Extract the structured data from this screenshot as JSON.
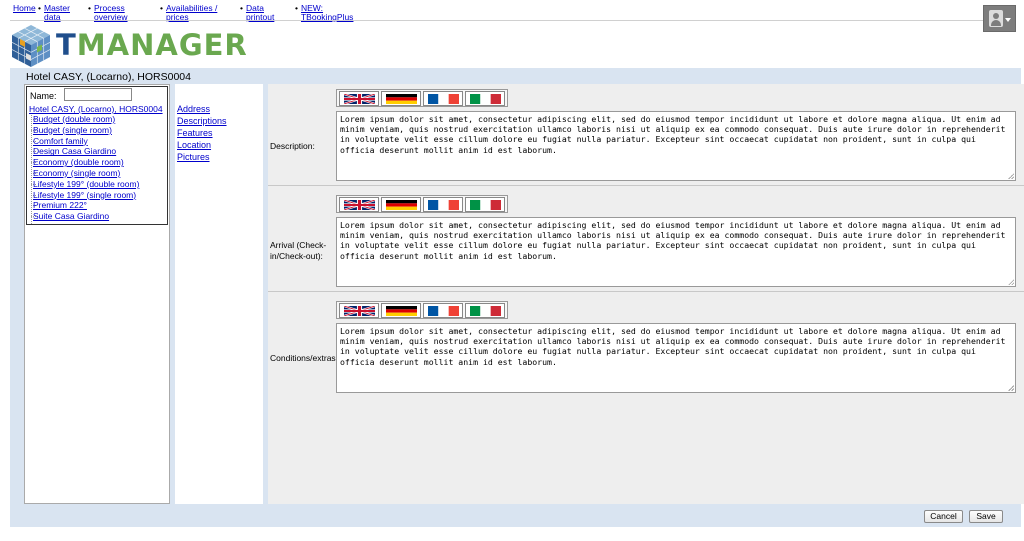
{
  "nav": {
    "items": [
      {
        "label": "Home"
      },
      {
        "label": "Master data"
      },
      {
        "label": "Process overview"
      },
      {
        "label": "Availabilities / prices"
      },
      {
        "label": "Data printout"
      },
      {
        "label": "NEW: TBookingPlus"
      }
    ]
  },
  "logo": {
    "text_t": "T",
    "text_rest": "MANAGER"
  },
  "hotel": {
    "title": "Hotel CASY, (Locarno), HORS0004"
  },
  "tree": {
    "name_label": "Name:",
    "name_value": "",
    "root": "Hotel CASY, (Locarno), HORS0004",
    "items": [
      "Budget (double room)",
      "Budget (single room)",
      "Comfort family",
      "Design Casa Giardino",
      "Economy (double room)",
      "Economy (single room)",
      "Lifestyle 199° (double room)",
      "Lifestyle 199° (single room)",
      "Premium 222°",
      "Suite Casa Giardino"
    ]
  },
  "links": [
    "Address",
    "Descriptions",
    "Features",
    "Location",
    "Pictures"
  ],
  "sections": [
    {
      "label": "Description:",
      "text": "Lorem ipsum dolor sit amet, consectetur adipiscing elit, sed do eiusmod tempor incididunt ut labore et dolore magna aliqua. Ut enim ad minim veniam, quis nostrud exercitation ullamco laboris nisi ut aliquip ex ea commodo consequat. Duis aute irure dolor in reprehenderit in voluptate velit esse cillum dolore eu fugiat nulla pariatur. Excepteur sint occaecat cupidatat non proident, sunt in culpa qui officia deserunt mollit anim id est laborum."
    },
    {
      "label": "Arrival (Check-in/Check-out):",
      "text": "Lorem ipsum dolor sit amet, consectetur adipiscing elit, sed do eiusmod tempor incididunt ut labore et dolore magna aliqua. Ut enim ad minim veniam, quis nostrud exercitation ullamco laboris nisi ut aliquip ex ea commodo consequat. Duis aute irure dolor in reprehenderit in voluptate velit esse cillum dolore eu fugiat nulla pariatur. Excepteur sint occaecat cupidatat non proident, sunt in culpa qui officia deserunt mollit anim id est laborum."
    },
    {
      "label": "Conditions/extras:",
      "text": "Lorem ipsum dolor sit amet, consectetur adipiscing elit, sed do eiusmod tempor incididunt ut labore et dolore magna aliqua. Ut enim ad minim veniam, quis nostrud exercitation ullamco laboris nisi ut aliquip ex ea commodo consequat. Duis aute irure dolor in reprehenderit in voluptate velit esse cillum dolore eu fugiat nulla pariatur. Excepteur sint occaecat cupidatat non proident, sunt in culpa qui officia deserunt mollit anim id est laborum."
    }
  ],
  "flags": [
    "flag-uk-icon",
    "flag-de-icon",
    "flag-fr-icon",
    "flag-it-icon"
  ],
  "buttons": {
    "cancel": "Cancel",
    "save": "Save"
  },
  "colors": {
    "link": "#0000cc",
    "logo_green": "#6aa84f",
    "logo_blue": "#1f4e8c",
    "frame": "#d9e4f1"
  }
}
